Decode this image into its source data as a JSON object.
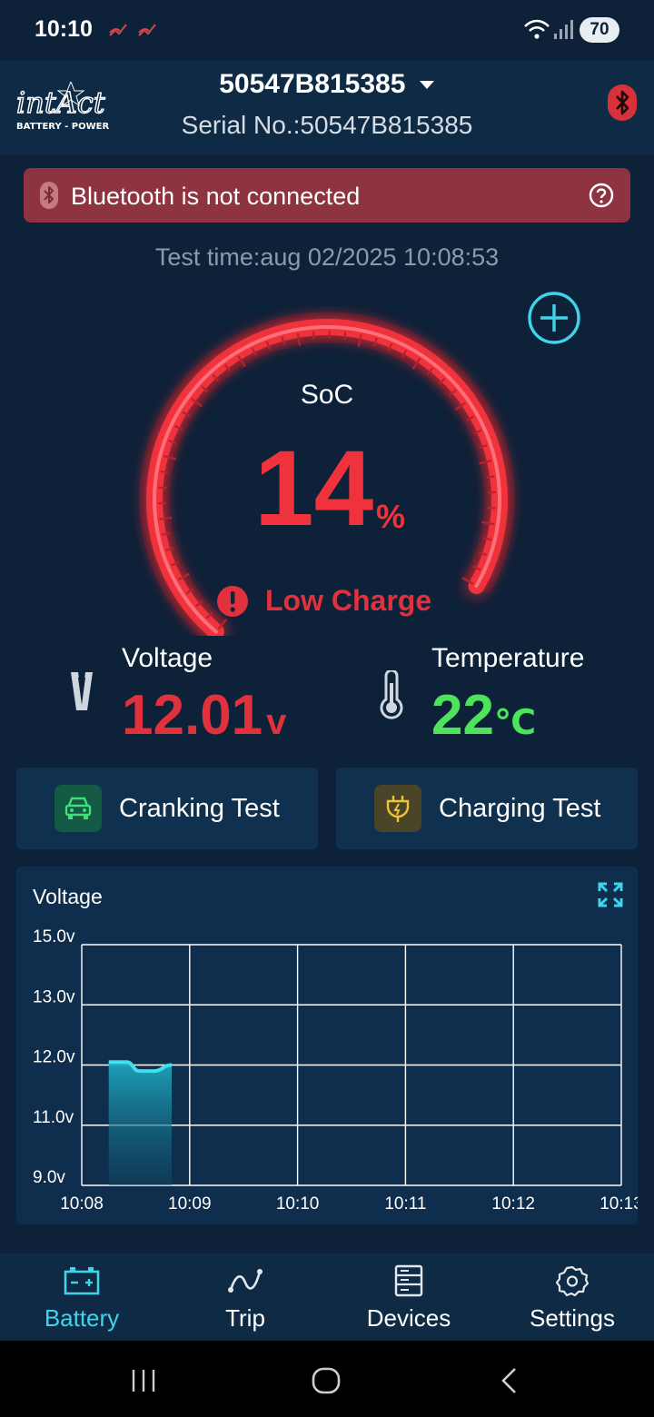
{
  "status_bar": {
    "time": "10:10",
    "battery_level": "70",
    "icons": [
      "missed-call-icon",
      "missed-call-icon",
      "wifi-icon",
      "signal-icon"
    ]
  },
  "header": {
    "device_name": "50547B815385",
    "serial": "Serial No.:50547B815385",
    "logo_icon": "intact-battery-power-logo",
    "bluetooth_icon": "bluetooth-icon"
  },
  "alert": {
    "text": "Bluetooth is not connected",
    "color": "#8e3340"
  },
  "test_time": "Test time:aug 02/2025 10:08:53",
  "soc": {
    "label": "SoC",
    "value": "14",
    "unit": "%",
    "level": 0.14,
    "status": "Low Charge",
    "color": "#f0323d"
  },
  "voltage": {
    "label": "Voltage",
    "value": "12.01",
    "unit": "v",
    "color": "#e0313d"
  },
  "temperature": {
    "label": "Temperature",
    "value": "22",
    "unit": "℃",
    "color": "#4de35a"
  },
  "tests": [
    {
      "label": "Cranking Test",
      "icon": "car-icon"
    },
    {
      "label": "Charging Test",
      "icon": "plug-icon"
    }
  ],
  "chart": {
    "title": "Voltage"
  },
  "chart_data": {
    "type": "area",
    "title": "Voltage",
    "x_ticks": [
      "10:08",
      "10:09",
      "10:10",
      "10:11",
      "10:12",
      "10:13"
    ],
    "y_ticks": [
      "15.0v",
      "13.0v",
      "12.0v",
      "11.0v",
      "9.0v"
    ],
    "y_tick_values": [
      15,
      13,
      12,
      11,
      9
    ],
    "series": [
      {
        "x": [
          "10:08:15",
          "10:08:25",
          "10:08:32",
          "10:08:40",
          "10:08:50"
        ],
        "values": [
          12.05,
          12.05,
          11.9,
          11.9,
          12.0
        ]
      }
    ],
    "grid": true,
    "line_color": "#3fe0ee"
  },
  "bottom_nav": [
    {
      "label": "Battery",
      "icon": "battery-icon",
      "active": true
    },
    {
      "label": "Trip",
      "icon": "trip-icon",
      "active": false
    },
    {
      "label": "Devices",
      "icon": "devices-icon",
      "active": false
    },
    {
      "label": "Settings",
      "icon": "gear-icon",
      "active": false
    }
  ],
  "accent_color": "#3fd4ea"
}
